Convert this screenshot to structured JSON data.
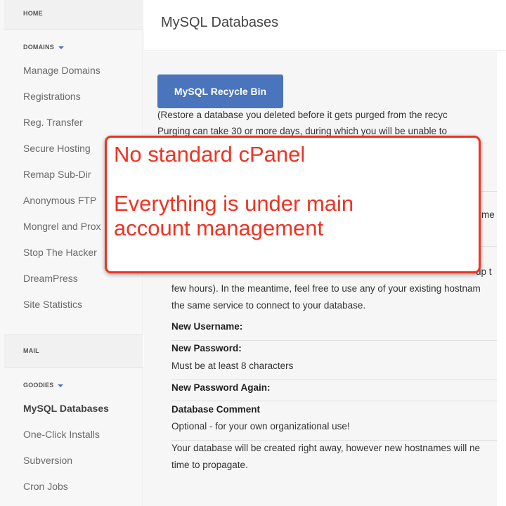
{
  "sidebar": {
    "home": "HOME",
    "domains": "DOMAINS",
    "domain_items": [
      "Manage Domains",
      "Registrations",
      "Reg. Transfer",
      "Secure Hosting",
      "Remap Sub-Dir",
      "Anonymous FTP",
      "Mongrel and Prox",
      "Stop The Hacker",
      "DreamPress",
      "Site Statistics"
    ],
    "mail": "MAIL",
    "goodies": "GOODIES",
    "goodies_items": [
      "MySQL Databases",
      "One-Click Installs",
      "Subversion",
      "Cron Jobs"
    ]
  },
  "header": {
    "title": "MySQL Databases"
  },
  "main": {
    "recycle_button": "MySQL Recycle Bin",
    "restore_line1": "(Restore a database you deleted before it gets purged from the recyc",
    "restore_line2": "Purging can take 30 or more days, during which you will be unable to",
    "hidden_fragment1": "me",
    "hidden_fragment2": "up t",
    "hostname_line2": "few hours). In the meantime, feel free to use any of your existing hostnam",
    "hostname_line3": "the same service to connect to your database.",
    "new_username_label": "New Username:",
    "new_password_label": "New Password:",
    "new_password_hint": "Must be at least 8 characters",
    "new_password_again_label": "New Password Again:",
    "db_comment_label": "Database Comment",
    "db_comment_hint": "Optional - for your own organizational use!",
    "footer_line1": "Your database will be created right away, however new hostnames will ne",
    "footer_line2": "time to propagate."
  },
  "annotation": {
    "line1": "No standard cPanel",
    "line2": "Everything is under main",
    "line3": "account management",
    "color": "#ee3322"
  },
  "colors": {
    "accent": "#4a75bd"
  }
}
